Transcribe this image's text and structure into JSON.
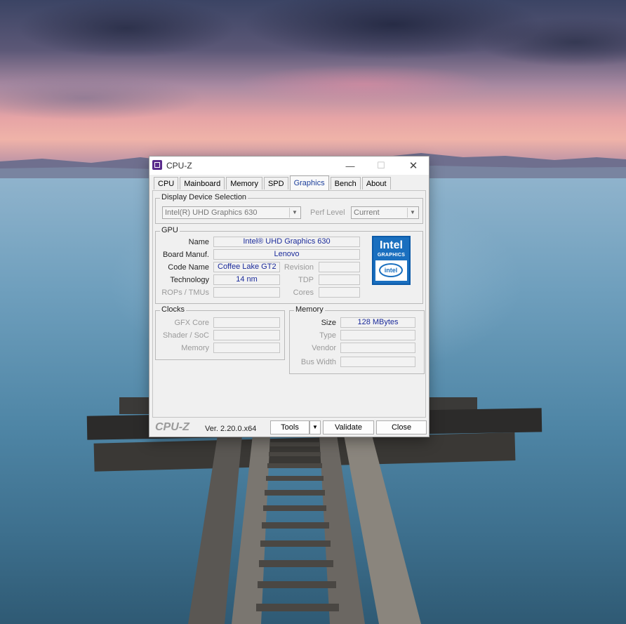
{
  "window": {
    "title": "CPU-Z",
    "minimize_glyph": "—",
    "maximize_glyph": "☐",
    "close_glyph": "✕"
  },
  "tabs": [
    {
      "label": "CPU",
      "active": false
    },
    {
      "label": "Mainboard",
      "active": false
    },
    {
      "label": "Memory",
      "active": false
    },
    {
      "label": "SPD",
      "active": false
    },
    {
      "label": "Graphics",
      "active": true
    },
    {
      "label": "Bench",
      "active": false
    },
    {
      "label": "About",
      "active": false
    }
  ],
  "display_device": {
    "group_label": "Display Device Selection",
    "device_value": "Intel(R) UHD Graphics 630",
    "perf_level_label": "Perf Level",
    "perf_level_value": "Current",
    "dropdown_glyph": "▼"
  },
  "gpu": {
    "group_label": "GPU",
    "name_label": "Name",
    "name_value": "Intel® UHD Graphics 630",
    "board_manuf_label": "Board Manuf.",
    "board_manuf_value": "Lenovo",
    "code_name_label": "Code Name",
    "code_name_value": "Coffee Lake GT2",
    "revision_label": "Revision",
    "revision_value": "",
    "technology_label": "Technology",
    "technology_value": "14 nm",
    "tdp_label": "TDP",
    "tdp_value": "",
    "rops_tmus_label": "ROPs / TMUs",
    "rops_tmus_value": "",
    "cores_label": "Cores",
    "cores_value": "",
    "logo": {
      "word": "Intel",
      "sub": "GRAPHICS",
      "oval": "intel"
    }
  },
  "clocks": {
    "group_label": "Clocks",
    "gfx_core_label": "GFX Core",
    "gfx_core_value": "",
    "shader_soc_label": "Shader / SoC",
    "shader_soc_value": "",
    "memory_label": "Memory",
    "memory_value": ""
  },
  "memory": {
    "group_label": "Memory",
    "size_label": "Size",
    "size_value": "128 MBytes",
    "type_label": "Type",
    "type_value": "",
    "vendor_label": "Vendor",
    "vendor_value": "",
    "bus_width_label": "Bus Width",
    "bus_width_value": ""
  },
  "bottom": {
    "brand": "CPU-Z",
    "version": "Ver. 2.20.0.x64",
    "tools_label": "Tools",
    "tools_arrow": "▼",
    "validate_label": "Validate",
    "close_label": "Close"
  },
  "colors": {
    "value_text": "#1a2a9a",
    "active_tab_text": "#1a3d9a",
    "intel_blue": "#1a6fbf"
  }
}
